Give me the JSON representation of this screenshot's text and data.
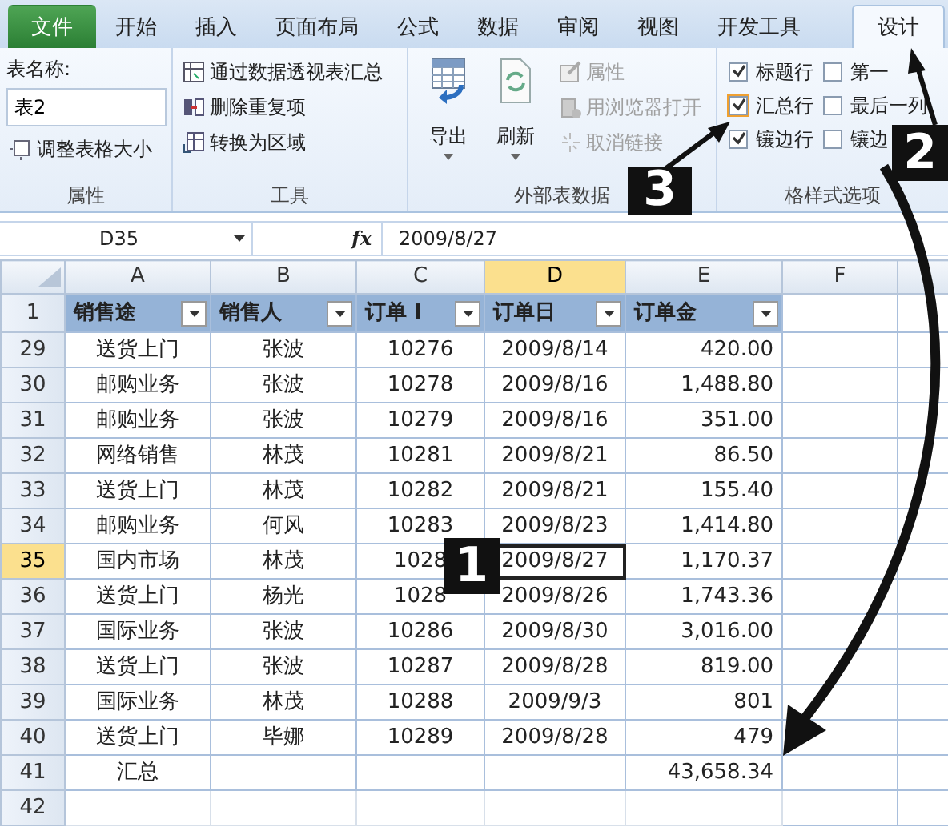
{
  "tabs": [
    {
      "label": "文件",
      "kind": "file",
      "selected": false
    },
    {
      "label": "开始",
      "kind": "tab",
      "selected": false
    },
    {
      "label": "插入",
      "kind": "tab",
      "selected": false
    },
    {
      "label": "页面布局",
      "kind": "tab",
      "selected": false
    },
    {
      "label": "公式",
      "kind": "tab",
      "selected": false
    },
    {
      "label": "数据",
      "kind": "tab",
      "selected": false
    },
    {
      "label": "审阅",
      "kind": "tab",
      "selected": false
    },
    {
      "label": "视图",
      "kind": "tab",
      "selected": false
    },
    {
      "label": "开发工具",
      "kind": "tab",
      "selected": false
    },
    {
      "label": "设计",
      "kind": "tab",
      "selected": true
    }
  ],
  "ribbon": {
    "properties": {
      "label": "属性",
      "name_label": "表名称:",
      "name_value": "表2",
      "resize": "调整表格大小"
    },
    "tools": {
      "label": "工具",
      "items": [
        "通过数据透视表汇总",
        "删除重复项",
        "转换为区域"
      ]
    },
    "external": {
      "label": "外部表数据",
      "large": [
        "导出",
        "刷新"
      ],
      "items": [
        {
          "label": "属性",
          "disabled": true
        },
        {
          "label": "用浏览器打开",
          "disabled": true
        },
        {
          "label": "取消链接",
          "disabled": true
        }
      ]
    },
    "style_options": {
      "label": "格样式选项",
      "options": [
        {
          "label": "标题行",
          "checked": true,
          "hovered": false
        },
        {
          "label": "汇总行",
          "checked": true,
          "hovered": true
        },
        {
          "label": "镶边行",
          "checked": true,
          "hovered": false
        },
        {
          "label": "第一",
          "checked": false,
          "hovered": false
        },
        {
          "label": "最后一列",
          "checked": false,
          "hovered": false
        },
        {
          "label": "镶边",
          "checked": false,
          "hovered": false
        }
      ]
    }
  },
  "formula_bar": {
    "name_box": "D35",
    "fx": "fx",
    "value": "2009/8/27"
  },
  "sheet": {
    "columns": [
      {
        "label": "A",
        "selected": false
      },
      {
        "label": "B",
        "selected": false
      },
      {
        "label": "C",
        "selected": false
      },
      {
        "label": "D",
        "selected": true
      },
      {
        "label": "E",
        "selected": false
      },
      {
        "label": "F",
        "selected": false
      }
    ],
    "rows": [
      {
        "number": "1",
        "kind": "header",
        "selected": false,
        "cells": [
          "销售途",
          "销售人",
          "订单 I",
          "订单日",
          "订单金"
        ]
      },
      {
        "number": "29",
        "kind": "data",
        "selected": false,
        "cells": [
          "送货上门",
          "张波",
          "10276",
          "2009/8/14",
          "420.00"
        ]
      },
      {
        "number": "30",
        "kind": "data",
        "selected": false,
        "cells": [
          "邮购业务",
          "张波",
          "10278",
          "2009/8/16",
          "1,488.80"
        ]
      },
      {
        "number": "31",
        "kind": "data",
        "selected": false,
        "cells": [
          "邮购业务",
          "张波",
          "10279",
          "2009/8/16",
          "351.00"
        ]
      },
      {
        "number": "32",
        "kind": "data",
        "selected": false,
        "cells": [
          "网络销售",
          "林茂",
          "10281",
          "2009/8/21",
          "86.50"
        ]
      },
      {
        "number": "33",
        "kind": "data",
        "selected": false,
        "cells": [
          "送货上门",
          "林茂",
          "10282",
          "2009/8/21",
          "155.40"
        ]
      },
      {
        "number": "34",
        "kind": "data",
        "selected": false,
        "cells": [
          "邮购业务",
          "何风",
          "10283",
          "2009/8/23",
          "1,414.80"
        ]
      },
      {
        "number": "35",
        "kind": "data",
        "selected": true,
        "cells": [
          "国内市场",
          "林茂",
          "1028",
          "2009/8/27",
          "1,170.37"
        ]
      },
      {
        "number": "36",
        "kind": "data",
        "selected": false,
        "cells": [
          "送货上门",
          "杨光",
          "1028",
          "2009/8/26",
          "1,743.36"
        ]
      },
      {
        "number": "37",
        "kind": "data",
        "selected": false,
        "cells": [
          "国际业务",
          "张波",
          "10286",
          "2009/8/30",
          "3,016.00"
        ]
      },
      {
        "number": "38",
        "kind": "data",
        "selected": false,
        "cells": [
          "送货上门",
          "张波",
          "10287",
          "2009/8/28",
          "819.00"
        ]
      },
      {
        "number": "39",
        "kind": "data",
        "selected": false,
        "cells": [
          "国际业务",
          "林茂",
          "10288",
          "2009/9/3",
          "801"
        ]
      },
      {
        "number": "40",
        "kind": "data",
        "selected": false,
        "cells": [
          "送货上门",
          "毕娜",
          "10289",
          "2009/8/28",
          "479"
        ]
      },
      {
        "number": "41",
        "kind": "total",
        "selected": false,
        "cells": [
          "汇总",
          null,
          null,
          null,
          "43,658.34"
        ]
      },
      {
        "number": "42",
        "kind": "empty",
        "selected": false
      }
    ]
  },
  "callouts": [
    {
      "label": "1"
    },
    {
      "label": "2"
    },
    {
      "label": "3"
    }
  ]
}
